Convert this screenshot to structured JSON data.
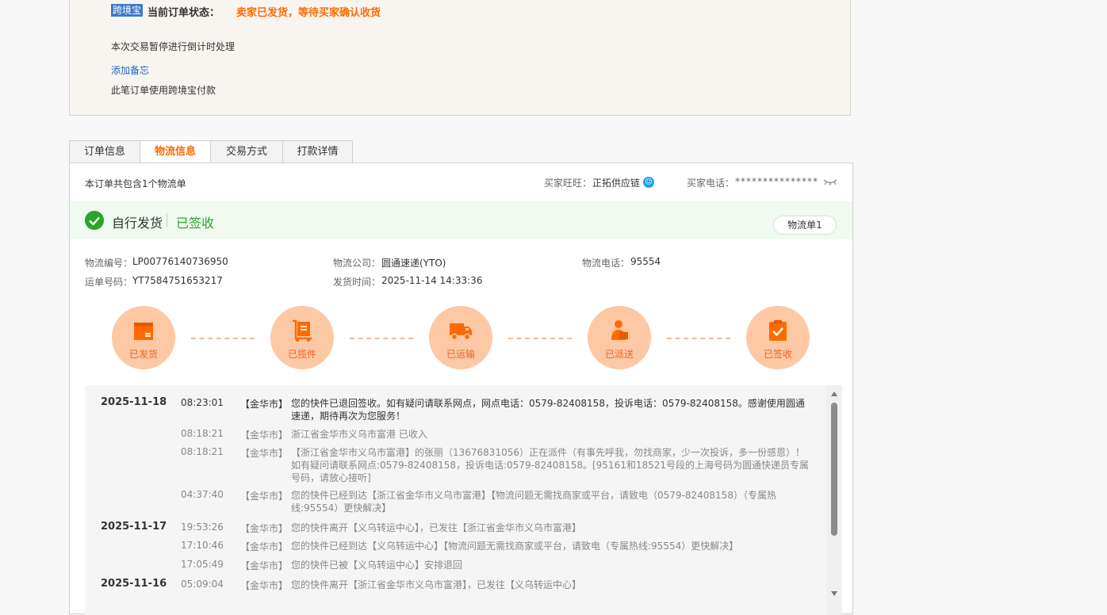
{
  "order_status": {
    "badge": "跨境宝",
    "label": "当前订单状态：",
    "value": "卖家已发货，等待买家确认收货",
    "pause_notice": "本次交易暂停进行倒计时处理",
    "add_note": "添加备忘",
    "payment_note": "此笔订单使用跨境宝付款"
  },
  "tabs": [
    {
      "label": "订单信息",
      "active": false
    },
    {
      "label": "物流信息",
      "active": true
    },
    {
      "label": "交易方式",
      "active": false
    },
    {
      "label": "打款详情",
      "active": false
    }
  ],
  "logistics": {
    "summary": "本订单共包含1个物流单",
    "buyer_wangwang_label": "买家旺旺：",
    "buyer_wangwang": "正拓供应链",
    "buyer_phone_label": "买家电话：",
    "buyer_phone": "***************",
    "ship_method": "自行发货",
    "ship_state": "已签收",
    "waybill_button": "物流单1",
    "fields": {
      "logistics_no_label": "物流编号：",
      "logistics_no": "LP00776140736950",
      "waybill_no_label": "运单号码：",
      "waybill_no": "YT7584751653217",
      "company_label": "物流公司：",
      "company": "圆通速递(YTO)",
      "ship_time_label": "发货时间：",
      "ship_time": "2025-11-14 14:33:36",
      "phone_label": "物流电话：",
      "phone": "95554"
    },
    "steps": [
      {
        "label": "已发货",
        "icon": "box-icon"
      },
      {
        "label": "已揽件",
        "icon": "cart-icon"
      },
      {
        "label": "已运输",
        "icon": "truck-icon"
      },
      {
        "label": "已派送",
        "icon": "courier-icon"
      },
      {
        "label": "已签收",
        "icon": "clipboard-check-icon"
      }
    ],
    "events": [
      {
        "date": "2025-11-18",
        "time": "08:23:01",
        "city": "【金华市】",
        "text": "您的快件已退回签收。如有疑问请联系网点，网点电话：0579-82408158，投诉电话：0579-82408158。感谢使用圆通速递，期待再次为您服务！"
      },
      {
        "date": "",
        "time": "08:18:21",
        "city": "【金华市】",
        "text": "浙江省金华市义乌市富港 已收入"
      },
      {
        "date": "",
        "time": "08:18:21",
        "city": "【金华市】",
        "text": "【浙江省金华市义乌市富港】的张丽（13676831056）正在派件（有事先呼我，勿找商家，少一次投诉，多一份感恩）！如有疑问请联系网点:0579-82408158，投诉电话:0579-82408158。[95161和18521号段的上海号码为圆通快递员专属号码，请放心接听]"
      },
      {
        "date": "",
        "time": "04:37:40",
        "city": "【金华市】",
        "text": "您的快件已经到达【浙江省金华市义乌市富港】【物流问题无需找商家或平台，请致电（0579-82408158）（专属热线:95554）更快解决】"
      },
      {
        "date": "2025-11-17",
        "time": "19:53:26",
        "city": "【金华市】",
        "text": "您的快件离开【义乌转运中心】，已发往【浙江省金华市义乌市富港】"
      },
      {
        "date": "",
        "time": "17:10:46",
        "city": "【金华市】",
        "text": "您的快件已经到达【义乌转运中心】【物流问题无需找商家或平台，请致电（专属热线:95554）更快解决】"
      },
      {
        "date": "",
        "time": "17:05:49",
        "city": "【金华市】",
        "text": "您的快件已被【义乌转运中心】安排退回"
      },
      {
        "date": "2025-11-16",
        "time": "05:09:04",
        "city": "【金华市】",
        "text": "您的快件离开【浙江省金华市义乌市富港】，已发往【义乌转运中心】"
      }
    ]
  }
}
